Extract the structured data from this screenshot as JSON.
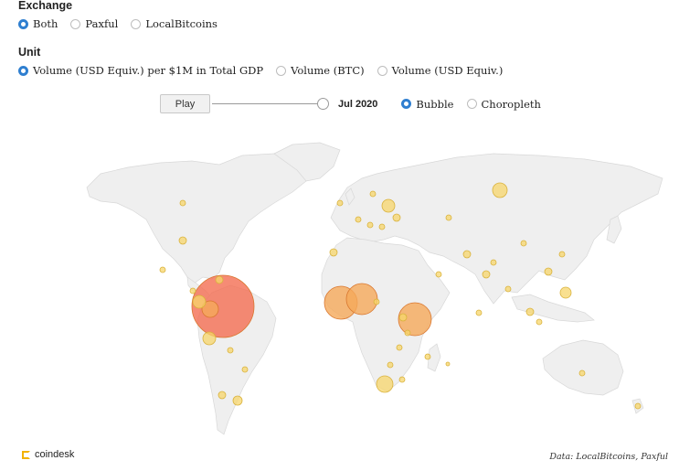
{
  "exchange": {
    "title": "Exchange",
    "options": [
      {
        "label": "Both",
        "selected": true
      },
      {
        "label": "Paxful",
        "selected": false
      },
      {
        "label": "LocalBitcoins",
        "selected": false
      }
    ]
  },
  "unit": {
    "title": "Unit",
    "options": [
      {
        "label": "Volume (USD Equiv.) per $1M in Total GDP",
        "selected": true
      },
      {
        "label": "Volume (BTC)",
        "selected": false
      },
      {
        "label": "Volume (USD Equiv.)",
        "selected": false
      }
    ]
  },
  "playback": {
    "play_label": "Play",
    "date": "Jul 2020",
    "slider_value": 1.0
  },
  "view": {
    "options": [
      {
        "label": "Bubble",
        "selected": true
      },
      {
        "label": "Choropleth",
        "selected": false
      }
    ]
  },
  "colors": {
    "land": "#efefef",
    "land_border": "#d8d8d8",
    "small_bubble": "#f7d66b",
    "medium_bubble": "#f5a95a",
    "large_bubble": "#f46e52",
    "selected_radio": "#2f7fd0",
    "brand": "#f2b200"
  },
  "footer": {
    "brand": "coindesk",
    "source": "Data: LocalBitcoins, Paxful"
  }
}
